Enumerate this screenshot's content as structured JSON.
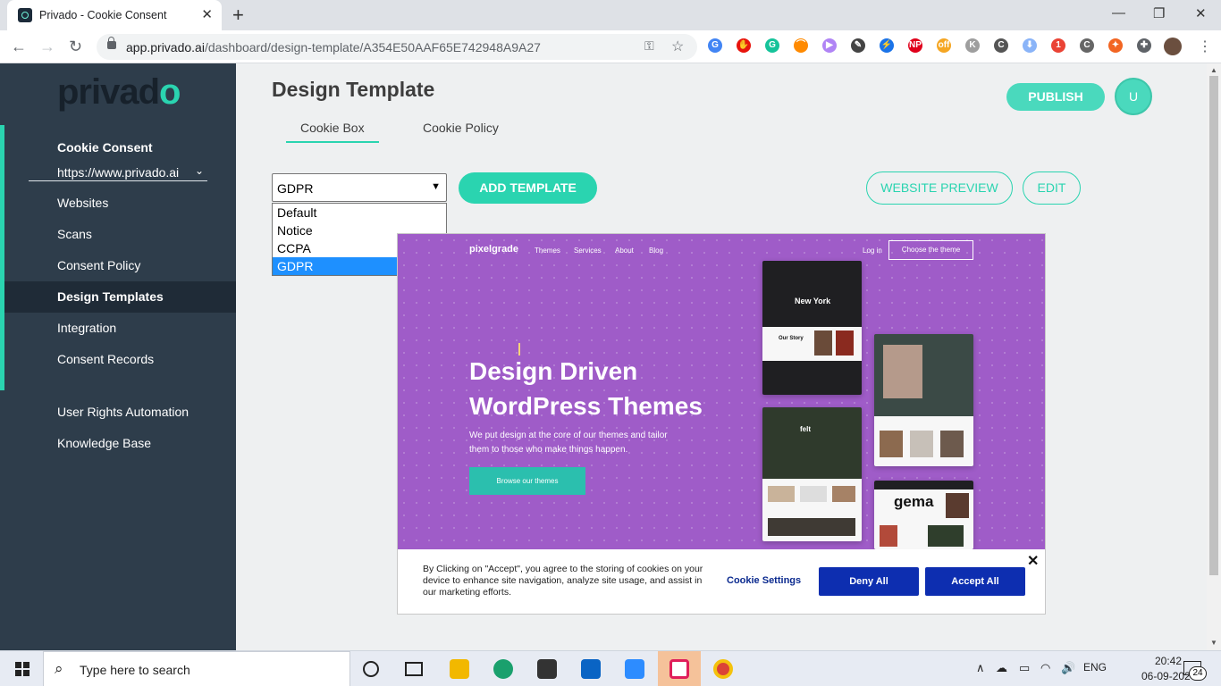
{
  "browser": {
    "tab_title": "Privado - Cookie Consent",
    "url_host": "app.privado.ai",
    "url_path": "/dashboard/design-template/A354E50AAF65E742948A9A27",
    "extensions": [
      {
        "name": "google-translate",
        "color": "#4285f4",
        "text": "G"
      },
      {
        "name": "adblock",
        "color": "#e8140c",
        "text": "✋"
      },
      {
        "name": "grammarly",
        "color": "#15c39a",
        "text": "G"
      },
      {
        "name": "colorful",
        "color": "#ff8a00",
        "text": "⌒"
      },
      {
        "name": "video",
        "color": "#b084f5",
        "text": "▶"
      },
      {
        "name": "dropper",
        "color": "#444",
        "text": "✎"
      },
      {
        "name": "bolt",
        "color": "#1a73e8",
        "text": "⚡"
      },
      {
        "name": "np",
        "color": "#e0001b",
        "text": "NP"
      },
      {
        "name": "coupon",
        "color": "#f5a623",
        "text": "off"
      },
      {
        "name": "k",
        "color": "#9e9e9e",
        "text": "K"
      },
      {
        "name": "c-ext",
        "color": "#555",
        "text": "C"
      },
      {
        "name": "download",
        "color": "#8ab4f8",
        "text": "⬇"
      },
      {
        "name": "cast",
        "color": "#ea4335",
        "text": "1"
      },
      {
        "name": "cc",
        "color": "#666",
        "text": "C"
      },
      {
        "name": "orange",
        "color": "#f26522",
        "text": "✦"
      },
      {
        "name": "puzzle",
        "color": "#5f6368",
        "text": "✚"
      }
    ]
  },
  "sidebar": {
    "logo_main": "privad",
    "logo_o": "o",
    "section": "Cookie Consent",
    "site": "https://www.privado.ai",
    "items": [
      {
        "label": "Websites"
      },
      {
        "label": "Scans"
      },
      {
        "label": "Consent Policy"
      },
      {
        "label": "Design Templates"
      },
      {
        "label": "Integration"
      },
      {
        "label": "Consent Records"
      },
      {
        "label": "User Rights Automation"
      },
      {
        "label": "Knowledge Base"
      }
    ]
  },
  "header": {
    "title": "Design Template",
    "publish": "PUBLISH",
    "avatar": "U"
  },
  "tabs": [
    "Cookie Box",
    "Cookie Policy"
  ],
  "template_select": {
    "value": "GDPR",
    "options": [
      "Default",
      "Notice",
      "CCPA",
      "GDPR"
    ]
  },
  "buttons": {
    "add_template": "ADD TEMPLATE",
    "website_preview": "WEBSITE PREVIEW",
    "edit": "EDIT"
  },
  "preview": {
    "logo": "pixelgrade",
    "nav": [
      "Themes",
      "Services",
      "About",
      "Blog"
    ],
    "login": "Log in",
    "choose": "Choose the theme",
    "headline": "Design Driven WordPress Themes",
    "subtext": "We put design at the core of our themes and tailor them to those who make things happen.",
    "browse": "Browse our themes",
    "mock_labels": [
      "New York",
      "Our Story",
      "felt",
      "gema"
    ]
  },
  "cookie": {
    "text": "By Clicking on \"Accept\", you agree to the storing of cookies on your device to enhance site navigation, analyze site usage, and assist in our marketing efforts.",
    "settings": "Cookie Settings",
    "deny": "Deny All",
    "accept": "Accept All",
    "close": "✕"
  },
  "taskbar": {
    "search_placeholder": "Type here to search",
    "lang": "ENG",
    "time": "20:42",
    "date": "06-09-2020",
    "notifications": "24"
  }
}
